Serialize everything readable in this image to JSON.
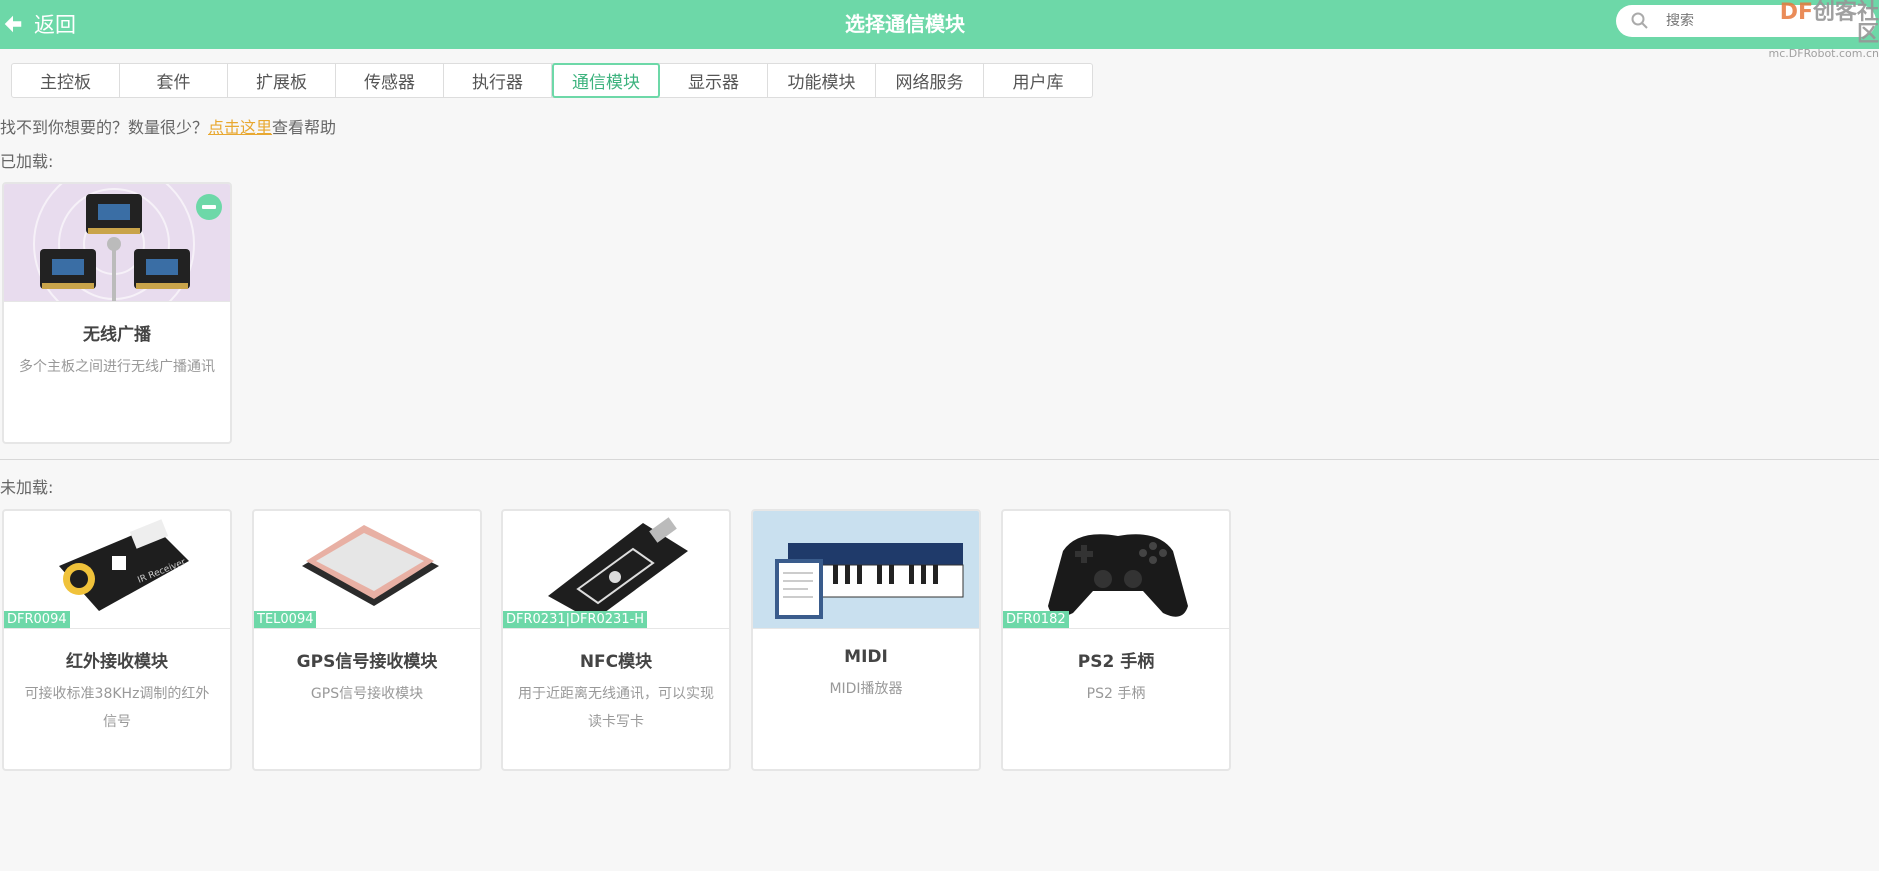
{
  "header": {
    "back_label": "返回",
    "title": "选择通信模块",
    "search_placeholder": "搜索",
    "watermark_line1_a": "DF",
    "watermark_line1_b": "创客社区",
    "watermark_line2": "mc.DFRobot.com.cn"
  },
  "tabs": [
    {
      "label": "主控板"
    },
    {
      "label": "套件"
    },
    {
      "label": "扩展板"
    },
    {
      "label": "传感器"
    },
    {
      "label": "执行器"
    },
    {
      "label": "通信模块",
      "active": true
    },
    {
      "label": "显示器"
    },
    {
      "label": "功能模块"
    },
    {
      "label": "网络服务"
    },
    {
      "label": "用户库"
    }
  ],
  "help": {
    "prefix": "找不到你想要的？数量很少？",
    "link": "点击这里",
    "suffix": "查看帮助"
  },
  "loaded": {
    "label": "已加载:",
    "items": [
      {
        "name": "无线广播",
        "desc": "多个主板之间进行无线广播通讯",
        "icon": "microbit-broadcast-image"
      }
    ]
  },
  "unloaded": {
    "label": "未加载:",
    "items": [
      {
        "name": "红外接收模块",
        "desc": "可接收标准38KHz调制的红外信号",
        "sku": "DFR0094",
        "icon": "ir-receiver-image"
      },
      {
        "name": "GPS信号接收模块",
        "desc": "GPS信号接收模块",
        "sku": "TEL0094",
        "icon": "gps-antenna-image"
      },
      {
        "name": "NFC模块",
        "desc": "用于近距离无线通讯，可以实现读卡写卡",
        "sku": "DFR0231|DFR0231-H",
        "icon": "nfc-board-image"
      },
      {
        "name": "MIDI",
        "desc": "MIDI播放器",
        "icon": "midi-keyboard-image"
      },
      {
        "name": "PS2 手柄",
        "desc": "PS2 手柄",
        "sku": "DFR0182",
        "icon": "gamepad-image"
      }
    ]
  },
  "colors": {
    "accent": "#6dd8a8",
    "link": "#e8a830",
    "active_tab_text": "#3db37e"
  }
}
